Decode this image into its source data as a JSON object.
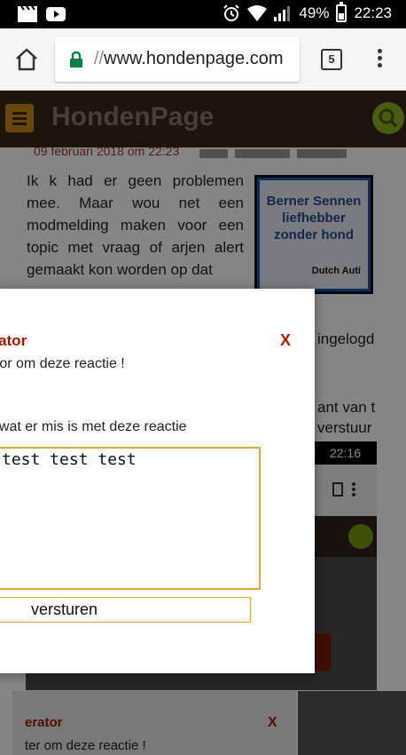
{
  "status_bar": {
    "battery": "49%",
    "time": "22:23"
  },
  "browser": {
    "url_scheme": "//",
    "url_host": "www.hondenpage.com",
    "tab_count": "5"
  },
  "site": {
    "title": "HondenPage"
  },
  "post": {
    "date": "09 februari 2018 om 22:23",
    "body": "Ik k had er geen problemen mee. Maar wou net een modmelding maken voor een topic met vraag of arjen alert gemaakt kon worden op dat",
    "banner_title": "Berner Sennen liefhebber zonder hond",
    "banner_sub": "Dutch Auti",
    "side_text_1": "ingelogd",
    "side_text_2": "ant van t",
    "side_text_3": "verstuur"
  },
  "embedded_screenshot": {
    "time": "22:16",
    "panel_title": "erator",
    "panel_close": "X",
    "panel_text": "ter om deze reactie !"
  },
  "modal": {
    "title": "erator",
    "close_label": "X",
    "line1": "ator om deze reactie !",
    "line2": "t wat er mis is met deze reactie",
    "textarea_value": "test test test",
    "submit_label": "versturen"
  },
  "colors": {
    "header_bg": "#3a2816",
    "accent_orange": "#e3a83a",
    "modal_title": "#9a1a00",
    "search_green": "#8db020"
  }
}
